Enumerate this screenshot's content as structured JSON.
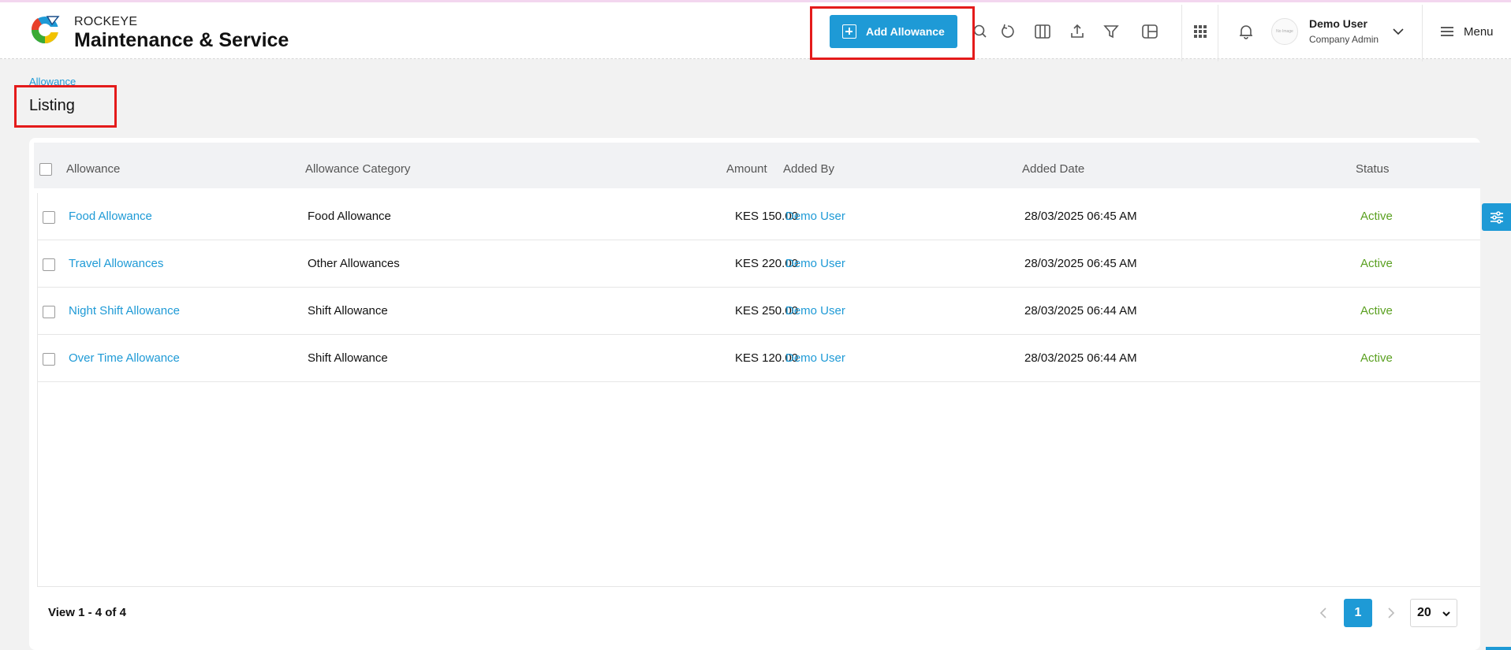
{
  "brand": {
    "small": "ROCKEYE",
    "big": "Maintenance & Service"
  },
  "header": {
    "add_button_label": "Add Allowance",
    "icons": [
      "search-icon",
      "refresh-icon",
      "columns-icon",
      "export-icon",
      "filter-icon",
      "layout-icon",
      "apps-grid-icon",
      "bell-icon"
    ],
    "user": {
      "name": "Demo User",
      "role": "Company Admin",
      "avatar_text": "No Image"
    },
    "menu_label": "Menu"
  },
  "breadcrumb": "Allowance",
  "page_title": "Listing",
  "table": {
    "columns": [
      "Allowance",
      "Allowance Category",
      "Amount",
      "Added By",
      "Added Date",
      "Status"
    ],
    "rows": [
      {
        "allowance": "Food Allowance",
        "category": "Food Allowance",
        "amount": "KES 150.00",
        "added_by": "Demo User",
        "added_date": "28/03/2025 06:45 AM",
        "status": "Active"
      },
      {
        "allowance": "Travel Allowances",
        "category": "Other Allowances",
        "amount": "KES 220.00",
        "added_by": "Demo User",
        "added_date": "28/03/2025 06:45 AM",
        "status": "Active"
      },
      {
        "allowance": "Night Shift Allowance",
        "category": "Shift Allowance",
        "amount": "KES 250.00",
        "added_by": "Demo User",
        "added_date": "28/03/2025 06:44 AM",
        "status": "Active"
      },
      {
        "allowance": "Over Time Allowance",
        "category": "Shift Allowance",
        "amount": "KES 120.00",
        "added_by": "Demo User",
        "added_date": "28/03/2025 06:44 AM",
        "status": "Active"
      }
    ]
  },
  "pagination": {
    "view_text": "View 1 - 4 of 4",
    "current_page": "1",
    "per_page": "20"
  },
  "colors": {
    "accent": "#1e9ad6",
    "active": "#5aa020",
    "highlight": "#e41b1b"
  }
}
